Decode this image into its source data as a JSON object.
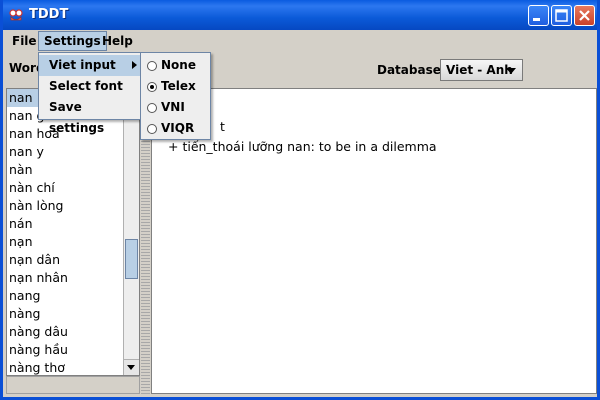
{
  "window": {
    "title": "TDDT"
  },
  "menubar": {
    "file": "File",
    "settings": "Settings",
    "help": "Help"
  },
  "settings_menu": {
    "items": [
      "Viet input",
      "Select font",
      "Save settings"
    ]
  },
  "viet_input_submenu": {
    "options": [
      "None",
      "Telex",
      "VNI",
      "VIQR"
    ],
    "selected": "Telex"
  },
  "toolbar": {
    "word_label": "Word",
    "database_label": "Database:",
    "database_value": "Viet - Anh"
  },
  "word_list": {
    "items": [
      "nan",
      "nan gi",
      "nan hoa",
      "nan y",
      "nàn",
      "nàn chí",
      "nàn lòng",
      "nán",
      "nạn",
      "nạn dân",
      "nạn nhân",
      "nang",
      "nàng",
      "nàng dâu",
      "nàng hầu",
      "nàng thơ"
    ],
    "selected_index": 0
  },
  "entry": {
    "word": "t",
    "definition": "+ tiến_thoái lưỡng nan: to be in a dilemma"
  },
  "colors": {
    "title_bar": "#0a5be0",
    "highlight": "#b8cfe5",
    "close_button": "#c9412a"
  }
}
